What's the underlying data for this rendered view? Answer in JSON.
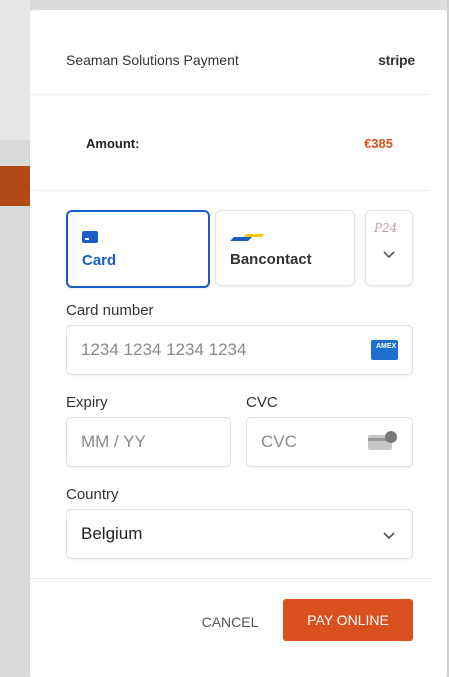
{
  "header": {
    "merchant": "Seaman Solutions Payment",
    "brand": "stripe"
  },
  "amount": {
    "label": "Amount:",
    "value": "€385"
  },
  "payment_methods": [
    {
      "label": "Card",
      "icon": "card-icon",
      "selected": true
    },
    {
      "label": "Bancontact",
      "icon": "bancontact-icon",
      "selected": false
    },
    {
      "label": "P24",
      "icon": "p24-icon",
      "selected": false
    }
  ],
  "form": {
    "card_number": {
      "label": "Card number",
      "placeholder": "1234 1234 1234 1234"
    },
    "expiry": {
      "label": "Expiry",
      "placeholder": "MM / YY"
    },
    "cvc": {
      "label": "CVC",
      "placeholder": "CVC"
    },
    "country": {
      "label": "Country",
      "value": "Belgium"
    }
  },
  "actions": {
    "cancel": "CANCEL",
    "pay": "PAY ONLINE"
  },
  "colors": {
    "accent": "#1a5cc8",
    "brand": "#d9501e"
  }
}
